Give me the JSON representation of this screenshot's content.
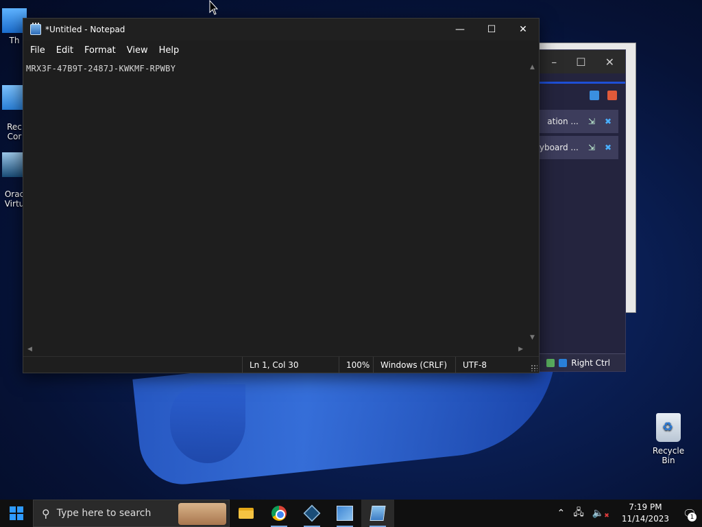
{
  "desktop": {
    "icons": [
      {
        "label": "Th"
      },
      {
        "label": "Rec\nCor"
      },
      {
        "label": "Orac\nVirtu"
      }
    ],
    "recycle_bin_label": "Recycle Bin"
  },
  "notepad": {
    "title": "*Untitled - Notepad",
    "menu": [
      "File",
      "Edit",
      "Format",
      "View",
      "Help"
    ],
    "content": "MRX3F-47B9T-2487J-KWKMF-RPWBY",
    "status": {
      "position": "Ln 1, Col 30",
      "zoom": "100%",
      "line_ending": "Windows (CRLF)",
      "encoding": "UTF-8"
    }
  },
  "background_window": {
    "rows": [
      "ation ...",
      "keyboard ..."
    ],
    "status_label": "Right Ctrl"
  },
  "taskbar": {
    "search_placeholder": "Type here to search",
    "time": "7:19 PM",
    "date": "11/14/2023",
    "notification_count": "1"
  },
  "colors": {
    "accent": "#2f9bff",
    "notepad_bg": "#1e1e1e",
    "taskbar_bg": "#101010"
  }
}
